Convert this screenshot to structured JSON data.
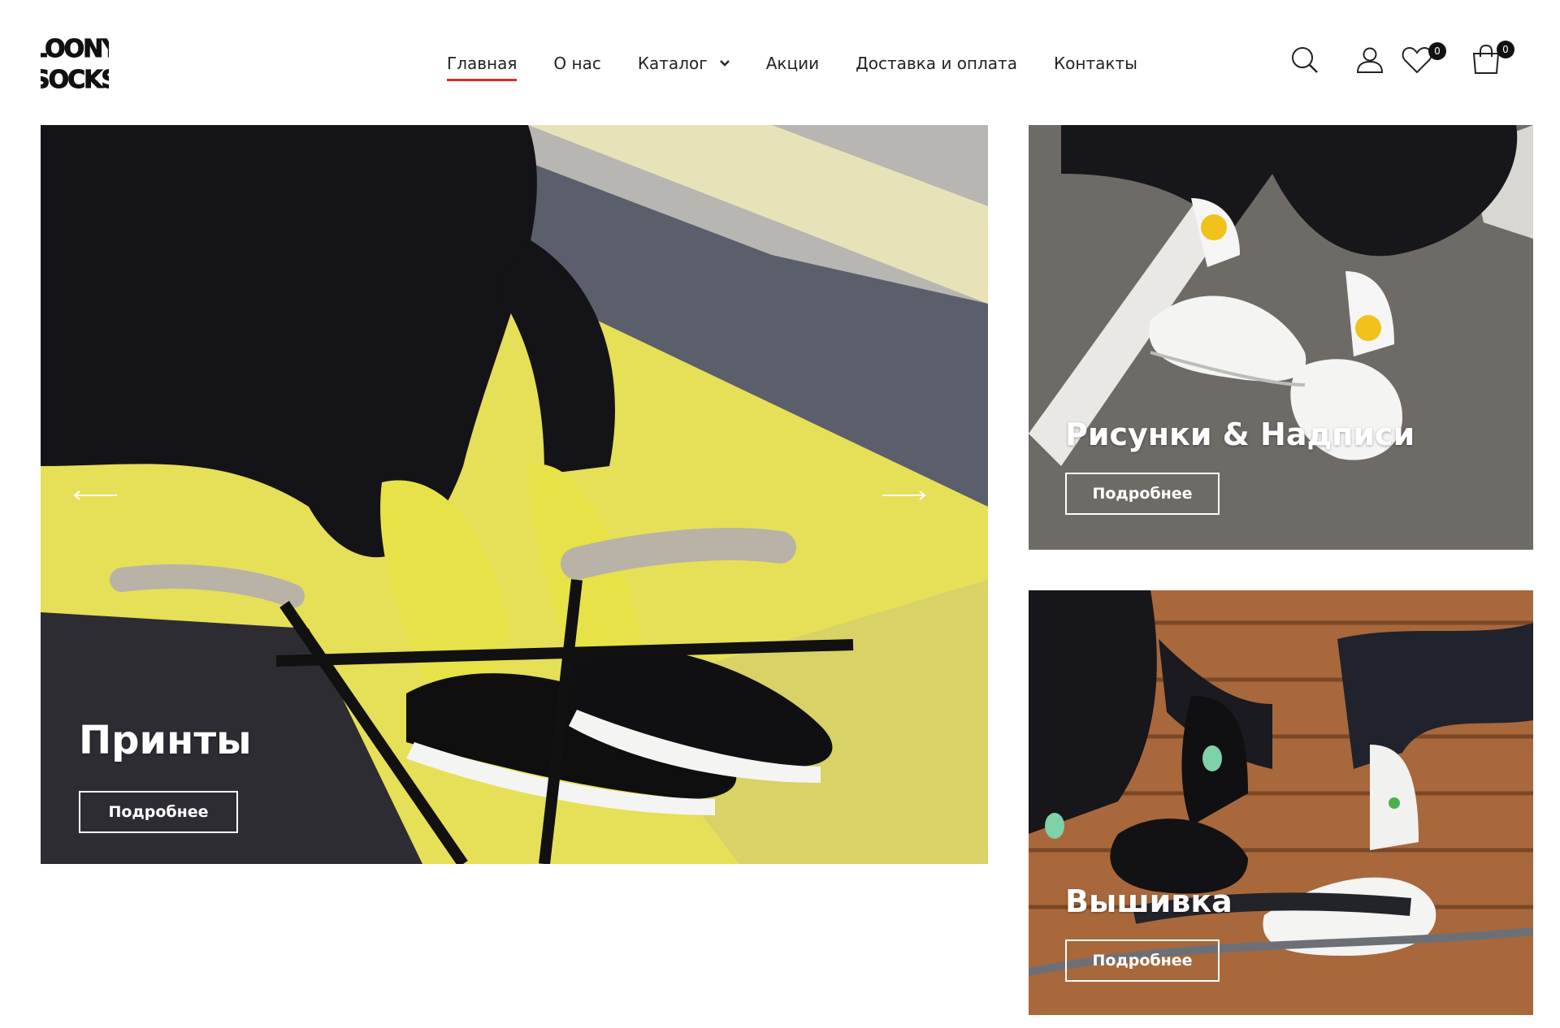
{
  "brand": {
    "logo_line1": "LOONY",
    "logo_line2": "SOCKS"
  },
  "nav": {
    "items": [
      {
        "label": "Главная",
        "active": true
      },
      {
        "label": "О нас"
      },
      {
        "label": "Каталог",
        "has_dropdown": true
      },
      {
        "label": "Акции"
      },
      {
        "label": "Доставка и оплата"
      },
      {
        "label": "Контакты"
      }
    ]
  },
  "header_icons": {
    "search": "search-icon",
    "account": "user-icon",
    "wishlist": {
      "icon": "heart-icon",
      "count": "0"
    },
    "cart": {
      "icon": "shopping-bag-icon",
      "count": "0"
    }
  },
  "hero": {
    "title": "Принты",
    "button": "Подробнее",
    "prev": "arrow-left-icon",
    "next": "arrow-right-icon"
  },
  "side_banners": [
    {
      "title": "Рисунки & Надписи",
      "button": "Подробнее"
    },
    {
      "title": "Вышивка",
      "button": "Подробнее"
    }
  ],
  "colors": {
    "accent": "#d32f2f",
    "text": "#222222",
    "badge": "#111111"
  }
}
